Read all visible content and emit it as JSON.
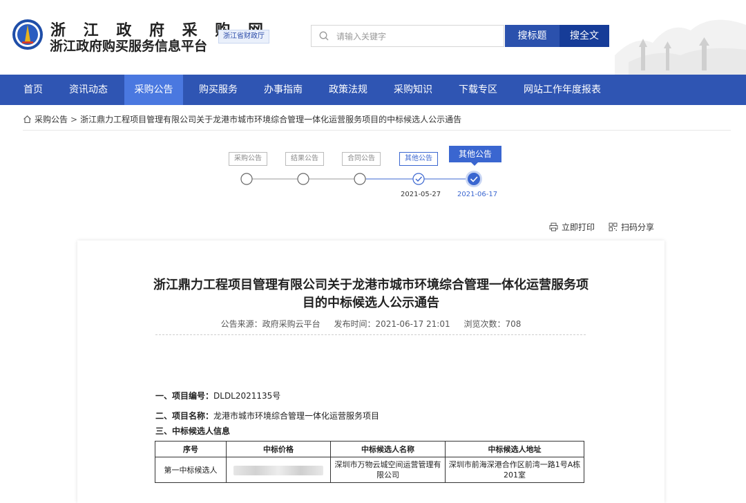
{
  "header": {
    "title_line1": "浙 江 政 府 采 购 网",
    "title_line2": "浙江政府购买服务信息平台",
    "dept_badge": "浙江省财政厅",
    "search_placeholder": "请输入关键字",
    "search_title_button": "搜标题",
    "search_full_button": "搜全文"
  },
  "nav": {
    "items": [
      {
        "label": "首页"
      },
      {
        "label": "资讯动态"
      },
      {
        "label": "采购公告"
      },
      {
        "label": "购买服务"
      },
      {
        "label": "办事指南"
      },
      {
        "label": "政策法规"
      },
      {
        "label": "采购知识"
      },
      {
        "label": "下载专区"
      },
      {
        "label": "网站工作年度报表"
      }
    ],
    "active_index": 2
  },
  "breadcrumb": {
    "root": "采购公告",
    "separator": ">",
    "current": "浙江鼎力工程项目管理有限公司关于龙港市城市环境综合管理一体化运营服务项目的中标候选人公示通告"
  },
  "timeline": {
    "steps": [
      {
        "label": "采购公告",
        "date": ""
      },
      {
        "label": "结果公告",
        "date": ""
      },
      {
        "label": "合同公告",
        "date": ""
      },
      {
        "label": "其他公告",
        "date": "2021-05-27"
      },
      {
        "label": "其他公告",
        "date": "2021-06-17"
      }
    ]
  },
  "actions": {
    "print": "立即打印",
    "share": "扫码分享"
  },
  "article": {
    "title": "浙江鼎力工程项目管理有限公司关于龙港市城市环境综合管理一体化运营服务项目的中标候选人公示通告",
    "source": "公告来源：政府采购云平台",
    "publish_time": "发布时间：2021-06-17 21:01",
    "views": "浏览次数：708",
    "section1_label": "一、项目编号：",
    "section1_value": "DLDL2021135号",
    "section2_label": "二、项目名称：",
    "section2_value": "龙港市城市环境综合管理一体化运营服务项目",
    "section3_label": "三、中标候选人信息",
    "table": {
      "headers": [
        "序号",
        "中标价格",
        "中标候选人名称",
        "中标候选人地址"
      ],
      "rows": [
        [
          "第一中标候选人",
          "",
          "深圳市万物云城空间运营管理有限公司",
          "深圳市前海深港合作区前湾一路1号A栋201室"
        ]
      ]
    }
  },
  "colors": {
    "nav_bg": "#2f55b3",
    "nav_active": "#4a78e0",
    "accent": "#3a66d0",
    "button_title": "#2b51ad",
    "button_full": "#163c98"
  }
}
